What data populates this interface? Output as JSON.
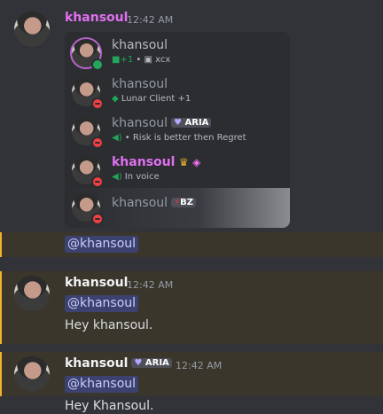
{
  "header_msg": {
    "username": "khansoul",
    "time": "12:42 AM"
  },
  "popup": {
    "rows": [
      {
        "name": "khansoul",
        "sub_a": "+1",
        "sub_b": "xcx"
      },
      {
        "name": "khansoul",
        "sub": "Lunar Client +1"
      },
      {
        "name": "khansoul",
        "tag": "ARIA",
        "sub": "• Risk is better then Regret"
      },
      {
        "name": "khansoul",
        "sub": "In voice"
      },
      {
        "name": "khansoul",
        "tag": "BZ"
      }
    ]
  },
  "mention_line": {
    "mention": "@khansoul"
  },
  "msg2": {
    "username": "khansoul",
    "time": "12:42 AM",
    "mention": "@khansoul",
    "text": "Hey khansoul."
  },
  "msg3": {
    "username": "khansoul",
    "tag": "ARIA",
    "time": "12:42 AM",
    "mention": "@khansoul",
    "text": "Hey Khansoul."
  },
  "colors": {
    "accent_name": "#e070f0",
    "mention_bg": "#3c4270",
    "highlight_border": "#f0b232"
  }
}
